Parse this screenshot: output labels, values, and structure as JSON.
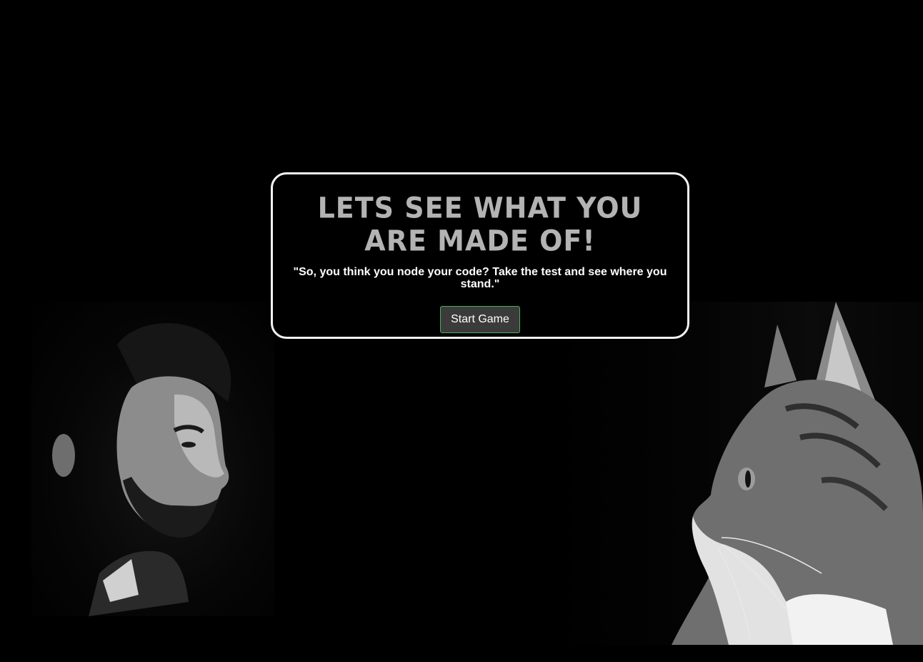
{
  "modal": {
    "title": "Lets see what you are made of!",
    "subtitle": "\"So, you think you node your code? Take the test and see where you stand.\"",
    "start_button_label": "Start Game"
  },
  "colors": {
    "background": "#000000",
    "title": "#b3b3b3",
    "button_border": "#4caf50",
    "button_bg": "#3b3b3b"
  }
}
